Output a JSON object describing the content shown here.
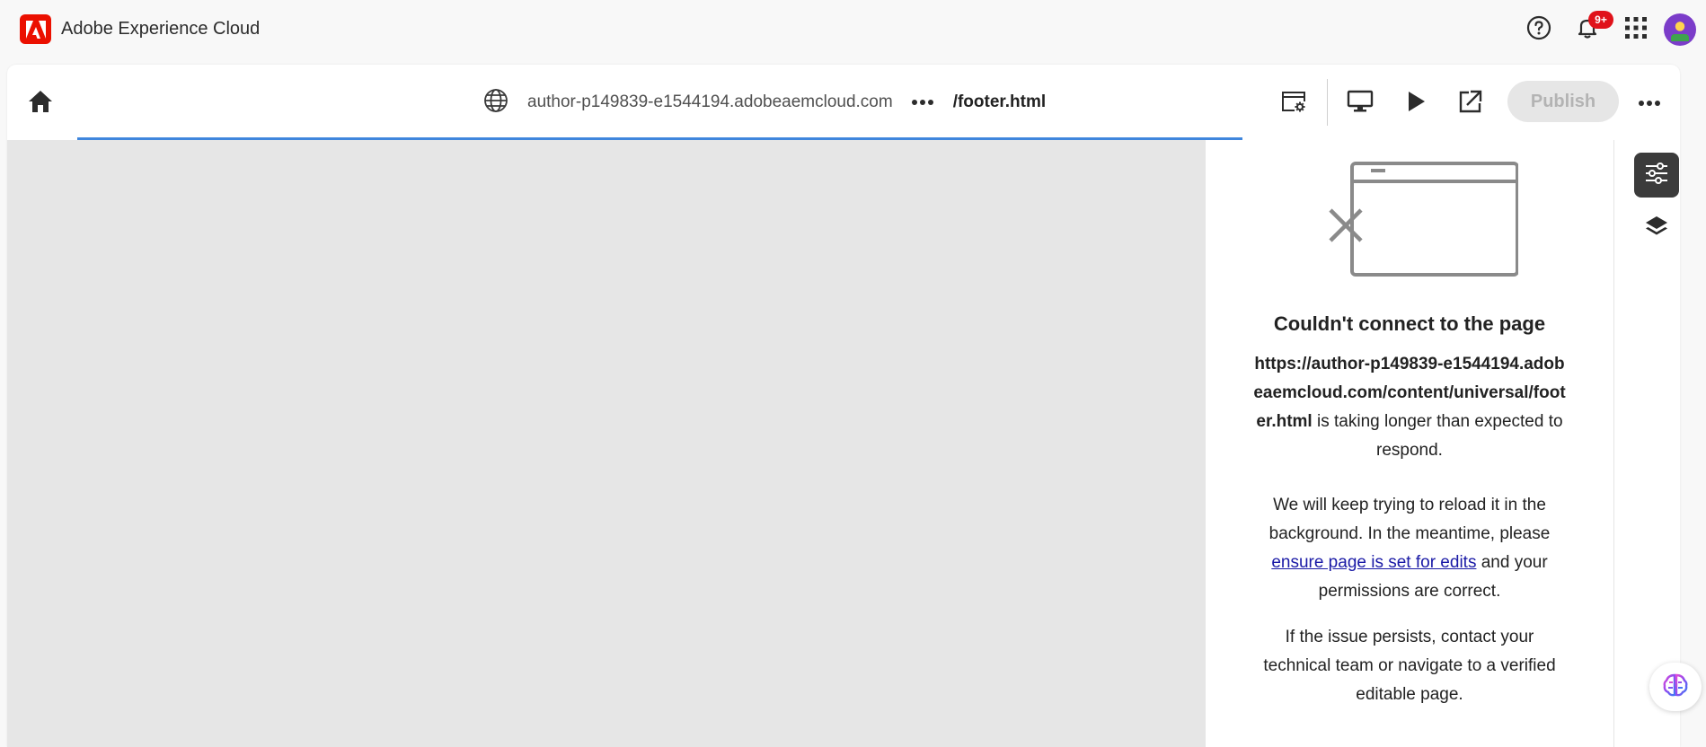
{
  "shell": {
    "brand_name": "Adobe Experience Cloud",
    "notifications_badge": "9+"
  },
  "toolbar": {
    "host": "author-p149839-e1544194.adobeaemcloud.com",
    "path": "/footer.html",
    "publish_label": "Publish"
  },
  "panel": {
    "title": "Couldn't connect to the page",
    "error_url": "https://author-p149839-e1544194.adobeaemcloud.com/content/universal/footer.html",
    "error_suffix": " is taking longer than expected to respond.",
    "retry_prefix": "We will keep trying to reload it in the background. In the meantime, please ",
    "retry_link": "ensure page is set for edits",
    "retry_suffix": " and your permissions are correct.",
    "persist_text": "If the issue persists, contact your technical team or navigate to a verified editable page."
  },
  "colors": {
    "brand_red": "#eb1000",
    "badge_red": "#e0121a",
    "progress_blue": "#3f86dd",
    "link_blue": "#1a1aa6",
    "canvas_gray": "#e6e6e6"
  },
  "icons": {
    "help": "help-circle-icon",
    "notifications": "bell-icon",
    "apps": "app-grid-icon",
    "home": "home-icon",
    "globe": "globe-icon",
    "more": "more-horizontal-icon",
    "page_properties": "page-properties-icon",
    "device_preview": "desktop-icon",
    "preview": "play-icon",
    "open_external": "open-in-new-icon",
    "properties_rail": "sliders-icon",
    "layers_rail": "layers-icon",
    "ai_assistant": "ai-assistant-icon"
  }
}
